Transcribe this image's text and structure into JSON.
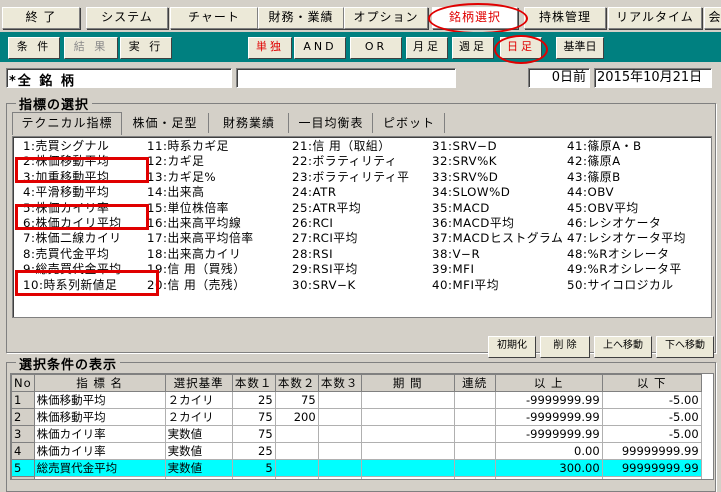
{
  "menu": {
    "items": [
      {
        "label": "終 了"
      },
      {
        "label": "システム"
      },
      {
        "label": "チャート"
      },
      {
        "label": "財務・業績"
      },
      {
        "label": "オプション"
      },
      {
        "label": "銘柄選択"
      },
      {
        "label": "持株管理"
      },
      {
        "label": "リアルタイム"
      },
      {
        "label": "会"
      }
    ]
  },
  "toolbar": {
    "conditions": "条 件",
    "results": "結 果",
    "execute": "実 行",
    "single": "単独",
    "and": "AND",
    "or": "OR",
    "monthly": "月足",
    "weekly": "週足",
    "daily": "日足",
    "base_date": "基準日"
  },
  "status": {
    "target": "*全 銘 柄",
    "middle": "",
    "days_before": "0日前",
    "date": "2015年10月21日"
  },
  "indicator_panel": {
    "title": "指標の選択",
    "tabs": [
      "テクニカル指標",
      "株価・足型",
      "財務業績",
      "一目均衡表",
      "ピボット"
    ],
    "columns": [
      [
        "1:売買シグナル",
        "2:株価移動平均",
        "3:加重移動平均",
        "4:平滑移動平均",
        "5:株価カイリ率",
        "6:株価カイリ平均",
        "7:株価二線カイリ",
        "8:売買代金平均",
        "9:総売買代金平均",
        "10:時系列新値足"
      ],
      [
        "11:時系カギ足",
        "12:カギ足",
        "13:カギ足%",
        "14:出来高",
        "15:単位株倍率",
        "16:出来高平均線",
        "17:出来高平均倍率",
        "18:出来高カイリ",
        "19:信 用（買残）",
        "20:信 用（売残）"
      ],
      [
        "21:信 用（取組）",
        "22:ボラティリティ",
        "23:ボラティリティ平",
        "24:ATR",
        "25:ATR平均",
        "26:RCI",
        "27:RCI平均",
        "28:RSI",
        "29:RSI平均",
        "30:SRV−K"
      ],
      [
        "31:SRV−D",
        "32:SRV%K",
        "33:SRV%D",
        "34:SLOW%D",
        "35:MACD",
        "36:MACD平均",
        "37:MACDヒストグラム",
        "38:V−R",
        "39:MFI",
        "40:MFI平均"
      ],
      [
        "41:篠原A・B",
        "42:篠原A",
        "43:篠原B",
        "44:OBV",
        "45:OBV平均",
        "46:レシオケータ",
        "47:レシオケータ平均",
        "48:%Rオシレータ",
        "49:%Rオシレータ平",
        "50:サイコロジカル"
      ]
    ]
  },
  "actions": {
    "initialize": "初期化",
    "delete": "削 除",
    "move_up": "上へ移動",
    "move_down": "下へ移動"
  },
  "conditions_panel": {
    "title": "選択条件の表示",
    "headers": [
      "No",
      "指 標 名",
      "選択基準",
      "本数１",
      "本数２",
      "本数３",
      "期 間",
      "連続",
      "以 上",
      "以 下"
    ],
    "rows": [
      [
        "1",
        "株価移動平均",
        "２カイリ",
        "25",
        "75",
        "",
        "",
        "",
        "-9999999.99",
        "-5.00"
      ],
      [
        "2",
        "株価移動平均",
        "２カイリ",
        "75",
        "200",
        "",
        "",
        "",
        "-9999999.99",
        "-5.00"
      ],
      [
        "3",
        "株価カイリ率",
        "実数値",
        "75",
        "",
        "",
        "",
        "",
        "-9999999.99",
        "-5.00"
      ],
      [
        "4",
        "株価カイリ率",
        "実数値",
        "25",
        "",
        "",
        "",
        "",
        "0.00",
        "99999999.99"
      ],
      [
        "5",
        "総売買代金平均",
        "実数値",
        "5",
        "",
        "",
        "",
        "",
        "300.00",
        "99999999.99"
      ],
      [
        "6",
        "",
        "",
        "",
        "",
        "",
        "",
        "",
        "",
        ""
      ]
    ]
  },
  "colors": {
    "toolbar_bg": "#008080",
    "highlight_row": "#00ffff",
    "annotation": "#e00000"
  }
}
